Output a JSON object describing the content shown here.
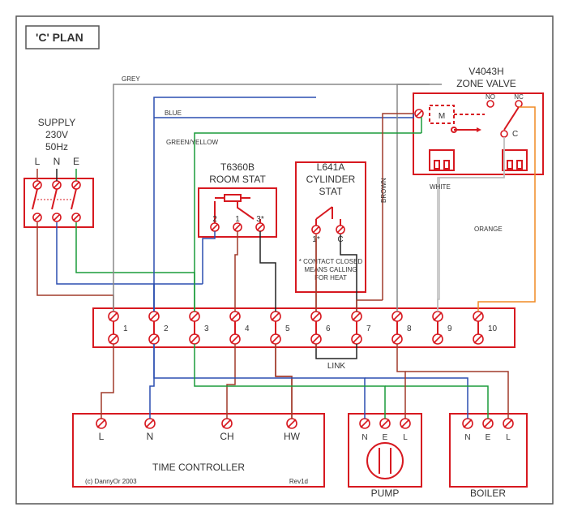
{
  "title": "'C' PLAN",
  "supply": {
    "label1": "SUPPLY",
    "label2": "230V",
    "label3": "50Hz",
    "t1": "L",
    "t2": "N",
    "t3": "E"
  },
  "roomstat": {
    "label1": "T6360B",
    "label2": "ROOM STAT",
    "t1": "2",
    "t2": "1",
    "t3": "3*"
  },
  "cylstat": {
    "label1": "L641A",
    "label2": "CYLINDER",
    "label3": "STAT",
    "t1": "1*",
    "t2": "C",
    "note1": "* CONTACT CLOSED",
    "note2": "MEANS CALLING",
    "note3": "FOR HEAT"
  },
  "zonevalve": {
    "label1": "V4043H",
    "label2": "ZONE VALVE",
    "m": "M",
    "no": "NO",
    "nc": "NC",
    "c": "C"
  },
  "junction": {
    "terms": [
      "1",
      "2",
      "3",
      "4",
      "5",
      "6",
      "7",
      "8",
      "9",
      "10"
    ],
    "link": "LINK"
  },
  "timecontroller": {
    "label": "TIME CONTROLLER",
    "t1": "L",
    "t2": "N",
    "t3": "CH",
    "t4": "HW",
    "rev": "Rev1d",
    "copy": "(c) DannyOr 2003"
  },
  "pump": {
    "label": "PUMP",
    "t1": "N",
    "t2": "E",
    "t3": "L"
  },
  "boiler": {
    "label": "BOILER",
    "t1": "N",
    "t2": "E",
    "t3": "L"
  },
  "wirelabels": {
    "grey": "GREY",
    "blue": "BLUE",
    "greenyellow": "GREEN/YELLOW",
    "brown": "BROWN",
    "white": "WHITE",
    "orange": "ORANGE"
  }
}
